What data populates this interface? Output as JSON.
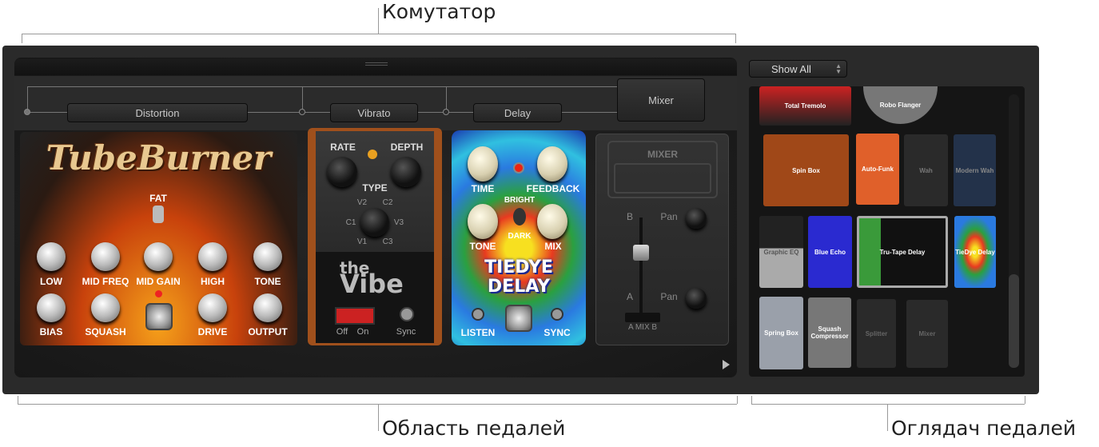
{
  "callouts": {
    "top": "Комутатор",
    "bottom_left": "Область педалей",
    "bottom_right": "Оглядач педалей"
  },
  "routing": {
    "buttons": [
      "Distortion",
      "Vibrato",
      "Delay",
      "Mixer"
    ]
  },
  "tubeburner": {
    "title": "TubeBurner",
    "switch": "FAT",
    "knobs_top": [
      "LOW",
      "MID FREQ",
      "MID GAIN",
      "HIGH",
      "TONE"
    ],
    "knobs_bottom": [
      "BIAS",
      "SQUASH",
      "DRIVE",
      "OUTPUT"
    ]
  },
  "vibe": {
    "rate": "RATE",
    "depth": "DEPTH",
    "type": "TYPE",
    "positions": [
      "V2",
      "C2",
      "C1",
      "V3",
      "V1",
      "C3"
    ],
    "logo_the": "the",
    "logo_vibe": "Vibe",
    "off": "Off",
    "on": "On",
    "sync": "Sync"
  },
  "tiedye": {
    "time": "TIME",
    "feedback": "FEEDBACK",
    "bright": "BRIGHT",
    "dark": "DARK",
    "tone": "TONE",
    "mix": "MIX",
    "logo1": "TIEDYE",
    "logo2": "DELAY",
    "listen": "LISTEN",
    "sync": "SYNC"
  },
  "mixer": {
    "title": "MIXER",
    "b": "B",
    "a": "A",
    "pan": "Pan",
    "mix": "A  MIX  B"
  },
  "browser": {
    "filter": "Show All",
    "pedals": [
      "Total Tremolo",
      "Robo Flanger",
      "Spin Box",
      "Auto-Funk",
      "Wah",
      "Modern Wah",
      "Graphic EQ",
      "Blue Echo",
      "Tru-Tape Delay",
      "TieDye Delay",
      "Spring Box",
      "Squash Compressor",
      "Splitter",
      "Mixer"
    ],
    "scroll_position": 1.0
  }
}
